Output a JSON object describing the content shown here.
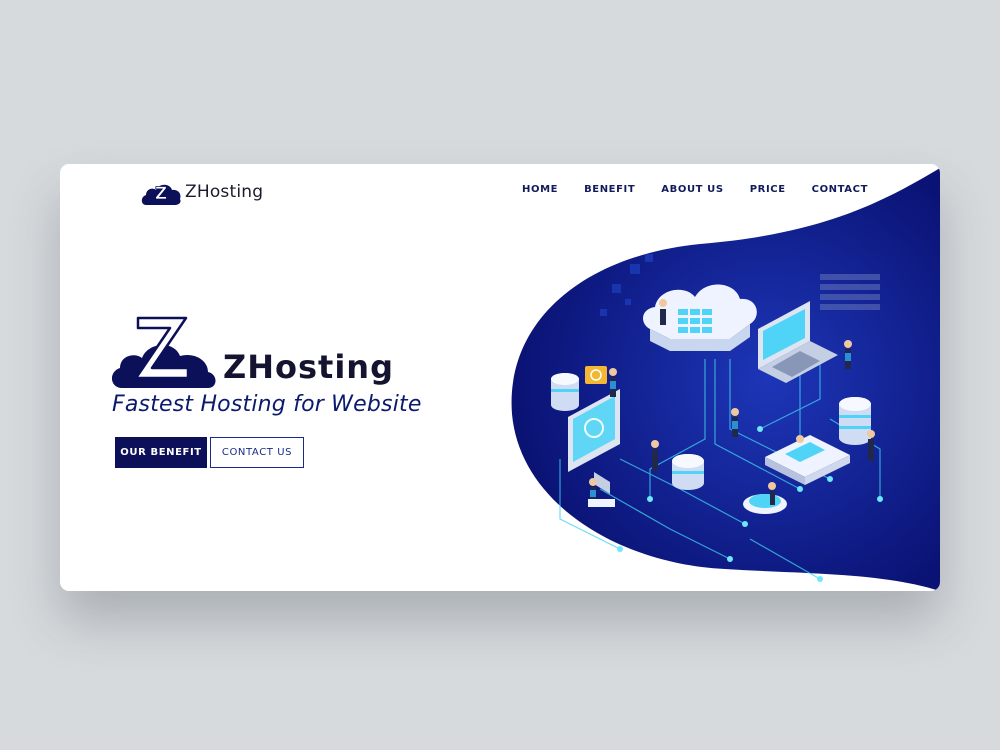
{
  "brand": {
    "name": "ZHosting",
    "logo_letter": "Z"
  },
  "nav": {
    "items": [
      {
        "label": "HOME"
      },
      {
        "label": "BENEFIT"
      },
      {
        "label": "ABOUT US"
      },
      {
        "label": "PRICE"
      },
      {
        "label": "CONTACT"
      }
    ]
  },
  "hero": {
    "title": "ZHosting",
    "tagline": "Fastest Hosting for Website",
    "primary_button": "OUR BENEFIT",
    "secondary_button": "CONTACT US"
  },
  "colors": {
    "navy": "#0b1058",
    "blob": "#0a1273",
    "accent_blue": "#1a2a8c",
    "cyan": "#3fd0f0",
    "background": "#d6dadd"
  },
  "illustration": {
    "name": "isometric-cloud-server-network-illustration"
  }
}
